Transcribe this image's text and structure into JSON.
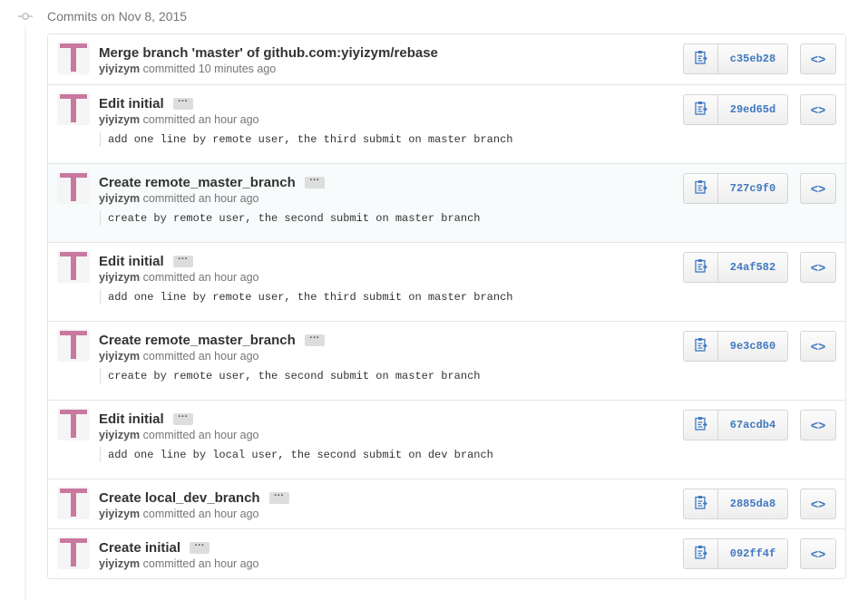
{
  "group": {
    "title": "Commits on Nov 8, 2015",
    "icon": "git-commit-icon"
  },
  "colors": {
    "sha": "#4078c0",
    "avatar": "#c9789f",
    "highlight_row": "#f7fbfc"
  },
  "commits": [
    {
      "title": "Merge branch 'master' of github.com:yiyizym/rebase",
      "author": "yiyizym",
      "time": "committed 10 minutes ago",
      "description": "",
      "sha": "c35eb28",
      "has_expander": false
    },
    {
      "title": "Edit initial",
      "author": "yiyizym",
      "time": "committed an hour ago",
      "description": "add one line by remote user, the third submit on master branch",
      "sha": "29ed65d",
      "has_expander": true
    },
    {
      "title": "Create remote_master_branch",
      "author": "yiyizym",
      "time": "committed an hour ago",
      "description": "create by remote user, the second submit on master branch",
      "sha": "727c9f0",
      "has_expander": true
    },
    {
      "title": "Edit initial",
      "author": "yiyizym",
      "time": "committed an hour ago",
      "description": "add one line by remote user, the third submit on master branch",
      "sha": "24af582",
      "has_expander": true
    },
    {
      "title": "Create remote_master_branch",
      "author": "yiyizym",
      "time": "committed an hour ago",
      "description": "create by remote user, the second submit on master branch",
      "sha": "9e3c860",
      "has_expander": true
    },
    {
      "title": "Edit initial",
      "author": "yiyizym",
      "time": "committed an hour ago",
      "description": "add one line by local user, the second submit on dev branch",
      "sha": "67acdb4",
      "has_expander": true
    },
    {
      "title": "Create local_dev_branch",
      "author": "yiyizym",
      "time": "committed an hour ago",
      "description": "",
      "sha": "2885da8",
      "has_expander": true
    },
    {
      "title": "Create initial",
      "author": "yiyizym",
      "time": "committed an hour ago",
      "description": "",
      "sha": "092ff4f",
      "has_expander": true
    }
  ],
  "labels": {
    "expander": "···",
    "browse": "<>"
  }
}
